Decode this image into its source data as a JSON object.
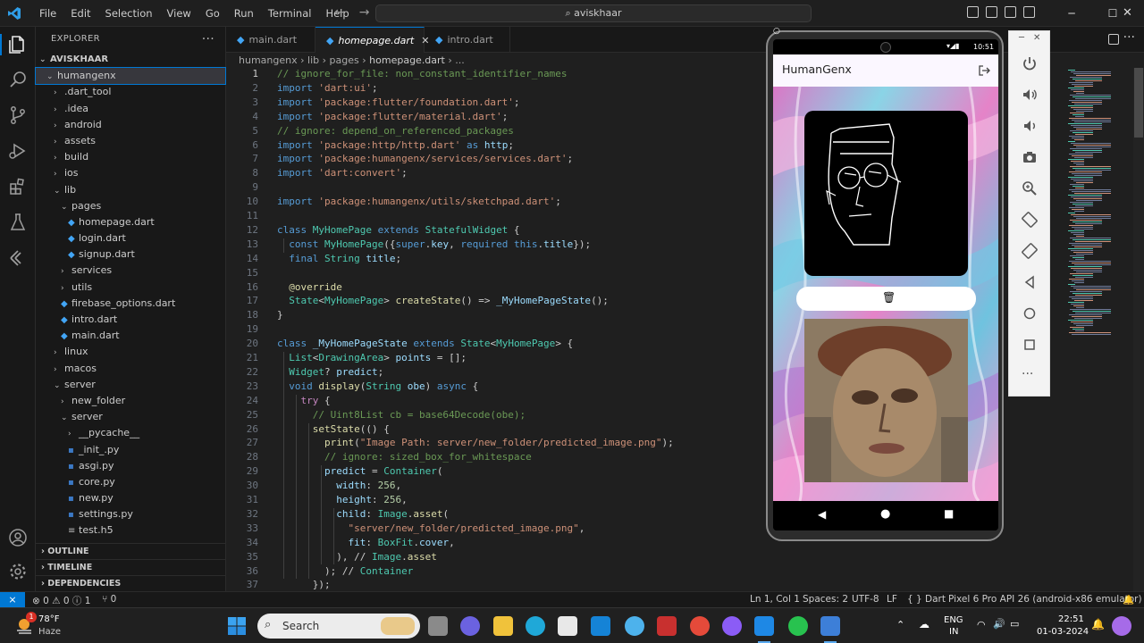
{
  "menu": [
    "File",
    "Edit",
    "Selection",
    "View",
    "Go",
    "Run",
    "Terminal",
    "Help"
  ],
  "search": {
    "value": "aviskhaar"
  },
  "explorer": {
    "title": "EXPLORER",
    "root": "AVISKHAAR",
    "tree": [
      {
        "label": "humangenx",
        "depth": 1,
        "type": "folder",
        "open": true,
        "selected": true
      },
      {
        "label": ".dart_tool",
        "depth": 2,
        "type": "folder",
        "open": false
      },
      {
        "label": ".idea",
        "depth": 2,
        "type": "folder",
        "open": false
      },
      {
        "label": "android",
        "depth": 2,
        "type": "folder",
        "open": false
      },
      {
        "label": "assets",
        "depth": 2,
        "type": "folder",
        "open": false
      },
      {
        "label": "build",
        "depth": 2,
        "type": "folder",
        "open": false
      },
      {
        "label": "ios",
        "depth": 2,
        "type": "folder",
        "open": false
      },
      {
        "label": "lib",
        "depth": 2,
        "type": "folder",
        "open": true
      },
      {
        "label": "pages",
        "depth": 3,
        "type": "folder",
        "open": true
      },
      {
        "label": "homepage.dart",
        "depth": 4,
        "type": "dart"
      },
      {
        "label": "login.dart",
        "depth": 4,
        "type": "dart"
      },
      {
        "label": "signup.dart",
        "depth": 4,
        "type": "dart"
      },
      {
        "label": "services",
        "depth": 3,
        "type": "folder",
        "open": false
      },
      {
        "label": "utils",
        "depth": 3,
        "type": "folder",
        "open": false
      },
      {
        "label": "firebase_options.dart",
        "depth": 3,
        "type": "dart"
      },
      {
        "label": "intro.dart",
        "depth": 3,
        "type": "dart"
      },
      {
        "label": "main.dart",
        "depth": 3,
        "type": "dart"
      },
      {
        "label": "linux",
        "depth": 2,
        "type": "folder",
        "open": false
      },
      {
        "label": "macos",
        "depth": 2,
        "type": "folder",
        "open": false
      },
      {
        "label": "server",
        "depth": 2,
        "type": "folder",
        "open": true
      },
      {
        "label": "new_folder",
        "depth": 3,
        "type": "folder",
        "open": false
      },
      {
        "label": "server",
        "depth": 3,
        "type": "folder",
        "open": true
      },
      {
        "label": "__pycache__",
        "depth": 4,
        "type": "folder",
        "open": false
      },
      {
        "label": "_init_.py",
        "depth": 4,
        "type": "py"
      },
      {
        "label": "asgi.py",
        "depth": 4,
        "type": "py"
      },
      {
        "label": "core.py",
        "depth": 4,
        "type": "py"
      },
      {
        "label": "new.py",
        "depth": 4,
        "type": "py"
      },
      {
        "label": "settings.py",
        "depth": 4,
        "type": "py"
      },
      {
        "label": "test.h5",
        "depth": 4,
        "type": "h5"
      }
    ],
    "sections": [
      "OUTLINE",
      "TIMELINE",
      "DEPENDENCIES"
    ]
  },
  "tabs": [
    {
      "label": "main.dart",
      "active": false
    },
    {
      "label": "homepage.dart",
      "active": true
    },
    {
      "label": "intro.dart",
      "active": false
    }
  ],
  "breadcrumb": [
    "humangenx",
    "lib",
    "pages",
    "homepage.dart",
    "..."
  ],
  "code": [
    {
      "n": "1",
      "t": "// ignore_for_file: non_constant_identifier_names",
      "c": "comment"
    },
    {
      "n": "2",
      "t": "import 'dart:ui';",
      "c": "import"
    },
    {
      "n": "3",
      "t": "import 'package:flutter/foundation.dart';",
      "c": "import"
    },
    {
      "n": "4",
      "t": "import 'package:flutter/material.dart';",
      "c": "import"
    },
    {
      "n": "5",
      "t": "// ignore: depend_on_referenced_packages",
      "c": "comment"
    },
    {
      "n": "6",
      "t": "import 'package:http/http.dart' as http;",
      "c": "import"
    },
    {
      "n": "7",
      "t": "import 'package:humangenx/services/services.dart';",
      "c": "import"
    },
    {
      "n": "8",
      "t": "import 'dart:convert';",
      "c": "import"
    },
    {
      "n": "9",
      "t": "",
      "c": "plain"
    },
    {
      "n": "10",
      "t": "import 'package:humangenx/utils/sketchpad.dart';",
      "c": "import"
    },
    {
      "n": "11",
      "t": "",
      "c": "plain"
    },
    {
      "n": "12",
      "t": "class MyHomePage extends StatefulWidget {",
      "c": "class"
    },
    {
      "n": "13",
      "t": "  const MyHomePage({super.key, required this.title});",
      "c": "plain"
    },
    {
      "n": "14",
      "t": "  final String title;",
      "c": "plain"
    },
    {
      "n": "15",
      "t": "",
      "c": "plain"
    },
    {
      "n": "16",
      "t": "  @override",
      "c": "plain"
    },
    {
      "n": "17",
      "t": "  State<MyHomePage> createState() => _MyHomePageState();",
      "c": "plain"
    },
    {
      "n": "18",
      "t": "}",
      "c": "plain"
    },
    {
      "n": "19",
      "t": "",
      "c": "plain"
    },
    {
      "n": "20",
      "t": "class _MyHomePageState extends State<MyHomePage> {",
      "c": "class"
    },
    {
      "n": "21",
      "t": "  List<DrawingArea> points = [];",
      "c": "plain"
    },
    {
      "n": "22",
      "t": "  Widget? predict;",
      "c": "plain"
    },
    {
      "n": "23",
      "t": "  void display(String obe) async {",
      "c": "plain"
    },
    {
      "n": "24",
      "t": "    try {",
      "c": "plain"
    },
    {
      "n": "25",
      "t": "      // Uint8List cb = base64Decode(obe);",
      "c": "comment"
    },
    {
      "n": "26",
      "t": "      setState(() {",
      "c": "plain"
    },
    {
      "n": "27",
      "t": "        print(\"Image Path: server/new_folder/predicted_image.png\");",
      "c": "plain"
    },
    {
      "n": "28",
      "t": "        // ignore: sized_box_for_whitespace",
      "c": "comment"
    },
    {
      "n": "29",
      "t": "        predict = Container(",
      "c": "plain"
    },
    {
      "n": "30",
      "t": "          width: 256,",
      "c": "plain"
    },
    {
      "n": "31",
      "t": "          height: 256,",
      "c": "plain"
    },
    {
      "n": "32",
      "t": "          child: Image.asset(",
      "c": "plain"
    },
    {
      "n": "33",
      "t": "            \"server/new_folder/predicted_image.png\",",
      "c": "string"
    },
    {
      "n": "34",
      "t": "            fit: BoxFit.cover,",
      "c": "plain"
    },
    {
      "n": "35",
      "t": "          ), // Image.asset",
      "c": "plain"
    },
    {
      "n": "36",
      "t": "        ); // Container",
      "c": "plain"
    },
    {
      "n": "37",
      "t": "      });",
      "c": "plain"
    }
  ],
  "emulator": {
    "time": "10:51",
    "app_title": "HumanGenx"
  },
  "statusbar": {
    "problems": "⊗ 0 ⚠ 0 ⓘ 1",
    "ports": "⑂ 0",
    "position": "Ln 1, Col 1",
    "spaces": "Spaces: 2",
    "encoding": "UTF-8",
    "eol": "LF",
    "language": "{ } Dart",
    "device": "Pixel 6 Pro API 26 (android-x86 emulator)"
  },
  "taskbar": {
    "weather_temp": "78°F",
    "weather_desc": "Haze",
    "search_label": "Search",
    "lang1": "ENG",
    "lang2": "IN",
    "time": "22:51",
    "date": "01-03-2024",
    "badge": "1"
  },
  "colors": {
    "accent": "#0078d4",
    "dart": "#42a5f5",
    "keyword": "#569cd6",
    "type": "#4ec9b0",
    "string": "#ce9178",
    "comment": "#6a9955",
    "func": "#dcdcaa",
    "var": "#9cdcfe",
    "control": "#c586c0"
  }
}
